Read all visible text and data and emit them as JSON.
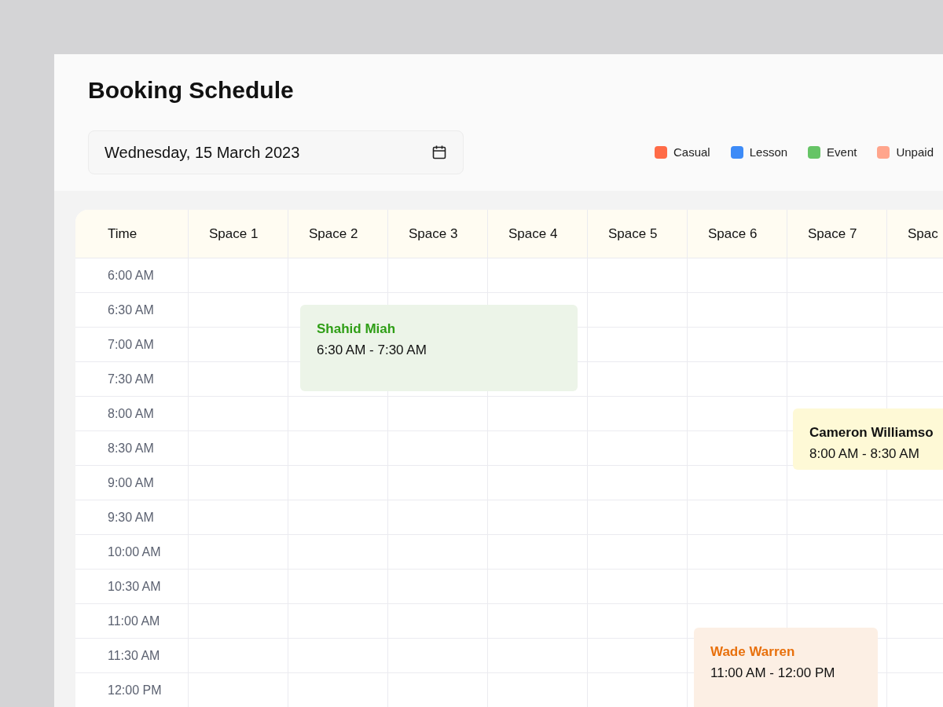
{
  "title": "Booking Schedule",
  "date_field": {
    "value": "Wednesday, 15 March 2023"
  },
  "legend": [
    {
      "label": "Casual",
      "color": "#ff6b47"
    },
    {
      "label": "Lesson",
      "color": "#3d8bf7"
    },
    {
      "label": "Event",
      "color": "#66c466"
    },
    {
      "label": "Unpaid",
      "color": "#ffa58c"
    }
  ],
  "table": {
    "time_header": "Time",
    "columns": [
      "Space 1",
      "Space 2",
      "Space 3",
      "Space 4",
      "Space 5",
      "Space 6",
      "Space 7",
      "Spac"
    ],
    "times": [
      "6:00 AM",
      "6:30 AM",
      "7:00 AM",
      "7:30 AM",
      "8:00 AM",
      "8:30 AM",
      "9:00 AM",
      "9:30 AM",
      "10:00 AM",
      "10:30 AM",
      "11:00 AM",
      "11:30 AM",
      "12:00 PM"
    ],
    "bookings": [
      {
        "name": "Shahid Miah",
        "time": "6:30 AM - 7:30 AM",
        "color": "#2f9e16",
        "kind": "green"
      },
      {
        "name": "Cameron Williamso",
        "time": "8:00 AM - 8:30 AM",
        "color": "#111111",
        "kind": "yellow"
      },
      {
        "name": "Wade Warren",
        "time": "11:00 AM - 12:00 PM",
        "color": "#e8700c",
        "kind": "orange"
      }
    ]
  }
}
